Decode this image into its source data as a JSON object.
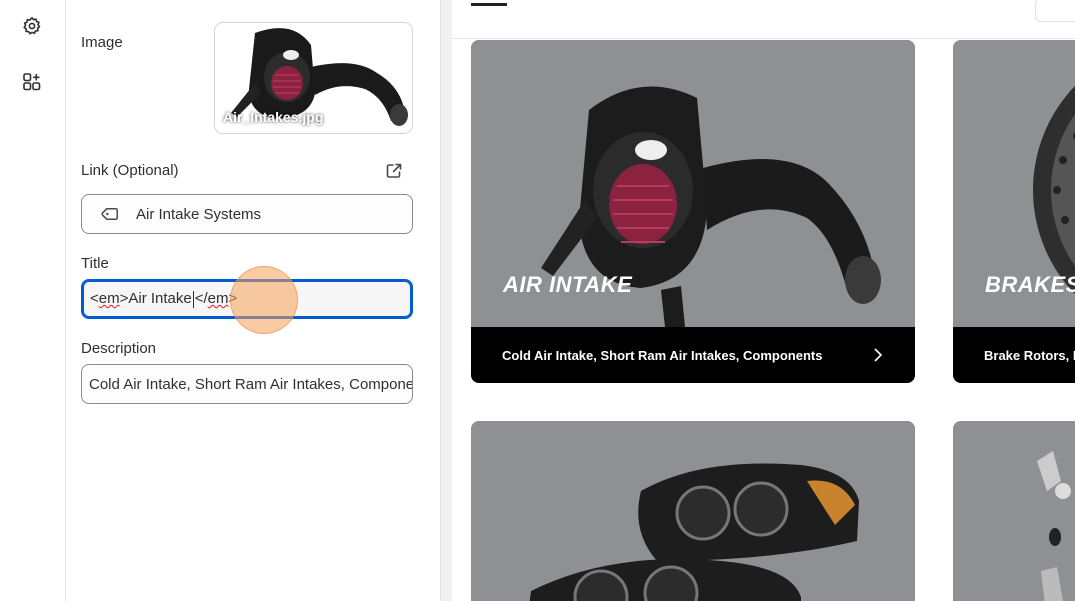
{
  "editor": {
    "image_label": "Image",
    "image_filename": "Air_Intakes.jpg",
    "link_label": "Link (Optional)",
    "link_value": "Air Intake Systems",
    "title_label": "Title",
    "title_value_parts": [
      "<",
      "em",
      ">Air Intake",
      "</",
      "em",
      ">"
    ],
    "description_label": "Description",
    "description_value": "Cold Air Intake, Short Ram Air Intakes, Components"
  },
  "preview": {
    "cards": [
      {
        "title": "AIR INTAKE",
        "subtitle": "Cold Air Intake, Short Ram Air Intakes, Components"
      },
      {
        "title": "BRAKES",
        "subtitle": "Brake Rotors, P"
      }
    ]
  },
  "colors": {
    "focus_ring": "#005bd3",
    "card_bar": "#000000",
    "card_photo": "#8f9094"
  },
  "icons": {
    "rail": [
      "gear-icon",
      "apps-add-icon"
    ],
    "link_field": "tag-icon",
    "link_external": "external-link-icon",
    "card_cta": "chevron-right-icon"
  }
}
